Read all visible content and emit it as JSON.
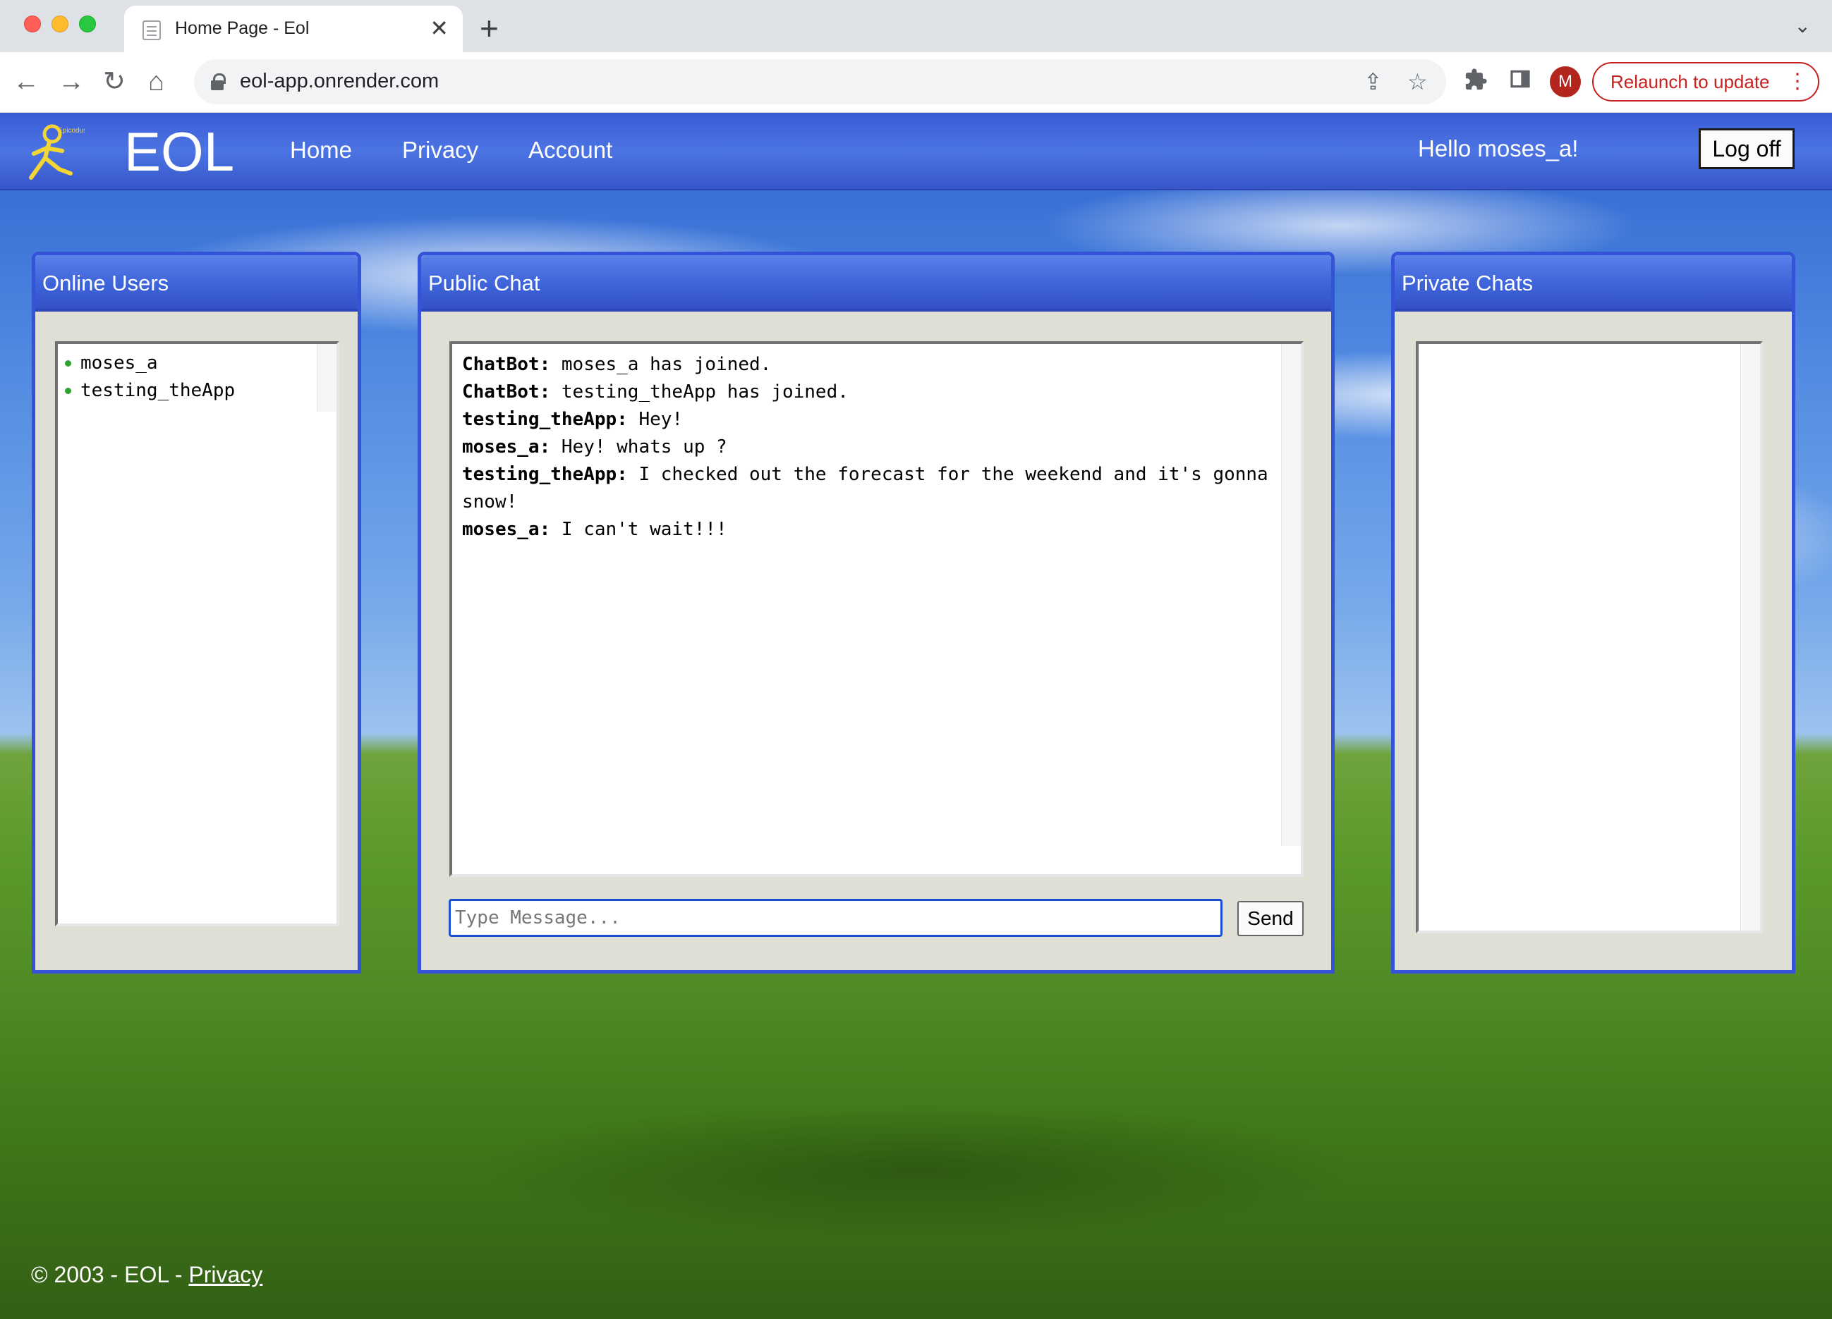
{
  "browser": {
    "tab_title": "Home Page - Eol",
    "url": "eol-app.onrender.com",
    "profile_initial": "M",
    "relaunch_label": "Relaunch to update"
  },
  "icons": {
    "back": "back-arrow-icon",
    "forward": "forward-arrow-icon",
    "reload": "reload-icon",
    "home": "home-icon",
    "lock": "lock-icon",
    "share": "share-icon",
    "bookmark": "star-icon",
    "extensions": "puzzle-icon",
    "sidepanel": "side-panel-icon"
  },
  "navbar": {
    "brand": "EOL",
    "logo_text": "Epicodus",
    "links": [
      "Home",
      "Privacy",
      "Account"
    ],
    "greeting": "Hello moses_a!",
    "logoff_label": "Log off"
  },
  "online_users": {
    "title": "Online Users",
    "users": [
      "moses_a",
      "testing_theApp"
    ]
  },
  "public_chat": {
    "title": "Public Chat",
    "messages": [
      {
        "sender": "ChatBot:",
        "text": " moses_a has joined."
      },
      {
        "sender": "ChatBot:",
        "text": " testing_theApp has joined."
      },
      {
        "sender": "testing_theApp:",
        "text": " Hey!"
      },
      {
        "sender": "moses_a:",
        "text": " Hey! whats up ?"
      },
      {
        "sender": "testing_theApp:",
        "text": " I checked out the forecast for the weekend and it's gonna snow!"
      },
      {
        "sender": "moses_a:",
        "text": " I can't wait!!!"
      }
    ],
    "input_placeholder": "Type Message...",
    "input_value": "",
    "send_label": "Send"
  },
  "private_chats": {
    "title": "Private Chats"
  },
  "footer": {
    "prefix": "© 2003 - EOL - ",
    "privacy_link": "Privacy"
  },
  "colors": {
    "navbar": "#4c74e2",
    "panel_border": "#3453d6",
    "panel_body": "#e0dfd6",
    "relaunch": "#c5221f",
    "online_dot": "#2fa02f"
  }
}
